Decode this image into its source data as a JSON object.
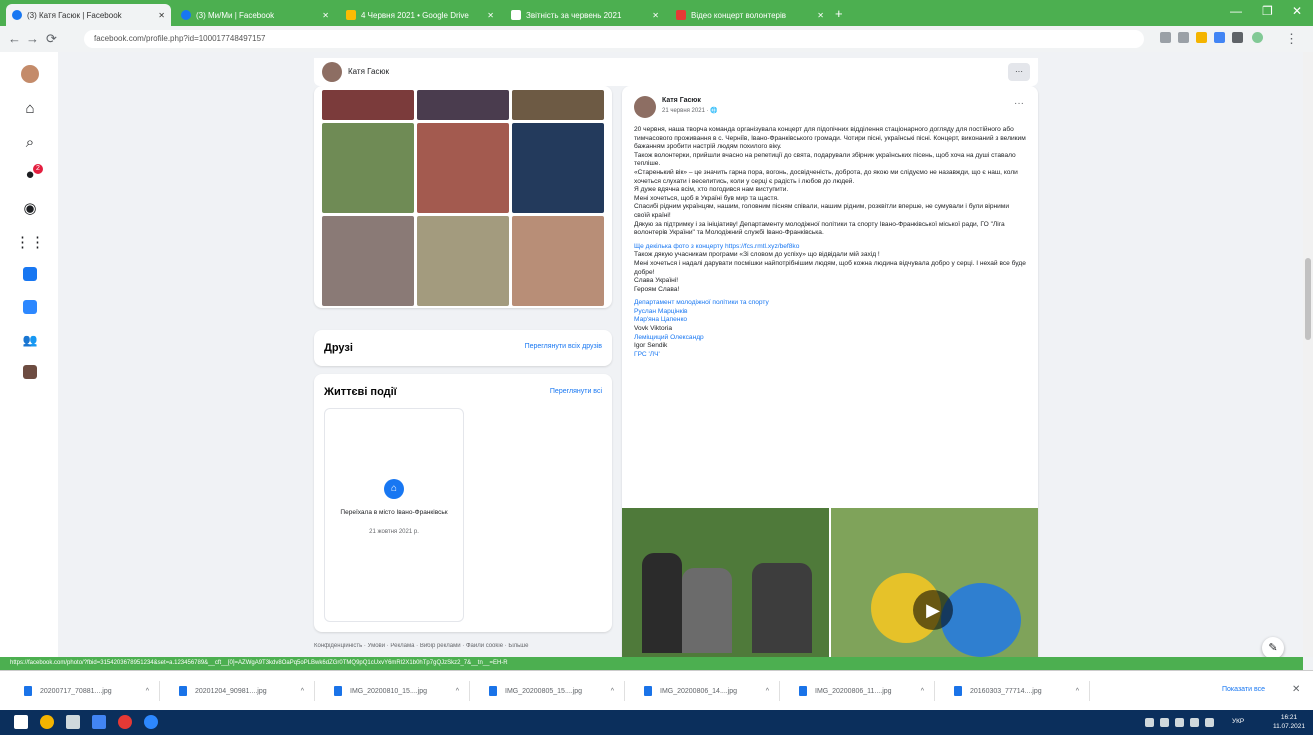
{
  "browser": {
    "tabs": [
      {
        "label": "(3) Катя Гасюк | Facebook",
        "active": true
      },
      {
        "label": "(3) Ми/Ми | Facebook",
        "active": false
      },
      {
        "label": "4 Червня 2021 • Google Drive",
        "active": false
      },
      {
        "label": "Звітність за червень 2021",
        "active": false
      },
      {
        "label": "Відео концерт волонтерів",
        "active": false
      }
    ],
    "new_tab_label": "+",
    "url": "facebook.com/profile.php?id=100017748497157"
  },
  "sidebar": {
    "items": [
      "profile",
      "home",
      "search",
      "notifications",
      "messenger",
      "menu",
      "watch",
      "pages",
      "groups",
      "photo"
    ],
    "notification_badge": "2"
  },
  "header": {
    "name": "Катя Гасюк",
    "more_label": "···"
  },
  "friends": {
    "title": "Друзі",
    "link": "Переглянути всіх друзів"
  },
  "life_events": {
    "title": "Життєві події",
    "link": "Переглянути всі",
    "event_title": "Переїхала в місто Івано-Франківськ",
    "event_date": "21 жовтня 2021 р."
  },
  "footer_text": "Конфіденційність · Умови · Реклама · Вибір реклами · Файли cookie · Більше",
  "post": {
    "author": "Катя Гасюк",
    "date": "21 червня 2021 · 🌐",
    "more_label": "···",
    "paragraphs": [
      "20 червня, наша творча команда організувала концерт для підопічних відділення стаціонарного догляду для постійного або тимчасового проживання в с. Черніїв, Івано-Франківського громади. Чотири пісні, українські пісні. Концерт, виконаний з великим бажанням зробити настрій людям похилого віку.",
      "Також волонтерки, прийшли вчасно на репетиції до свята, подарували збірник українських пісень, щоб хоча на душі ставало тепліше.",
      "«Старенький вік» – це значить гарна пора, вогонь, досвідченість, доброта, до якою ми слідуємо не назавжди, що є наш, коли хочеться слухати і веселитись, коли у серці є радість і любов до людей.",
      "Я дуже вдячна всім, хто погодився нам виступити.",
      "Мені хочеться, щоб в Україні був мир та щастя.",
      "Спасибі рідним українцям, нашим, головним пісням співали, нашим рідним, розквітли вперше, не сумували і були вірними своїй країні!",
      "Дякую за підтримку і за ініціативу! Департаменту молодіжної політики та спорту Івано-Франківської міської ради, ГО \"Ліга волонтерів України\" та Молодіжний службі Івано-Франківська."
    ],
    "link_line": "Ще декілька фото з концерту https://fcs.rmtl.xyz/bef8ko",
    "thanks_lines": [
      "Також дякую учасникам програми «Зі словом до успіху» що відвідали мій захід !",
      "Мені хочеться і надалі дарувати посмішки найпотрібнішим людям, щоб кожна людина відчувала добро у серці. І нехай все буде добре!",
      "Слава Україні!",
      "Героям Слава!"
    ],
    "tags": [
      {
        "label": "Департамент молодіжної політики та спорту",
        "link": true
      },
      {
        "label": "Руслан Марцінків",
        "link": true
      },
      {
        "label": "Мар'яна Цапенко",
        "link": true
      },
      {
        "label": "Vovk Viktoria",
        "link": false
      },
      {
        "label": "Леміщиций Олександр",
        "link": true
      },
      {
        "label": "Igor Sendik",
        "link": false
      },
      {
        "label": "ГРС 'ЛЧ'",
        "link": true
      }
    ]
  },
  "status_url": "https://facebook.com/photo/?fbid=3154203678951234&set=a.123456789&__cft__[0]=AZWgA9T3kdv8OaPq5oPLBwk6dZGr0TMQ9pQ1cUxvY6mRl2X1b0hTp7gQJzSkz2_7&__tn__=EH-R",
  "downloads": {
    "items": [
      "20200717_70881....jpg",
      "20201204_90981....jpg",
      "IMG_20200810_15....jpg",
      "IMG_20200805_15....jpg",
      "IMG_20200806_14....jpg",
      "IMG_20200806_11....jpg",
      "20160303_77714....jpg"
    ],
    "show_all": "Показати все"
  },
  "taskbar": {
    "time": "16:21",
    "date": "11.07.2021",
    "lang": "УКР"
  },
  "colors": {
    "accent": "#1877f2",
    "chrome_green": "#4caf50",
    "taskbar": "#0b2f5c"
  }
}
